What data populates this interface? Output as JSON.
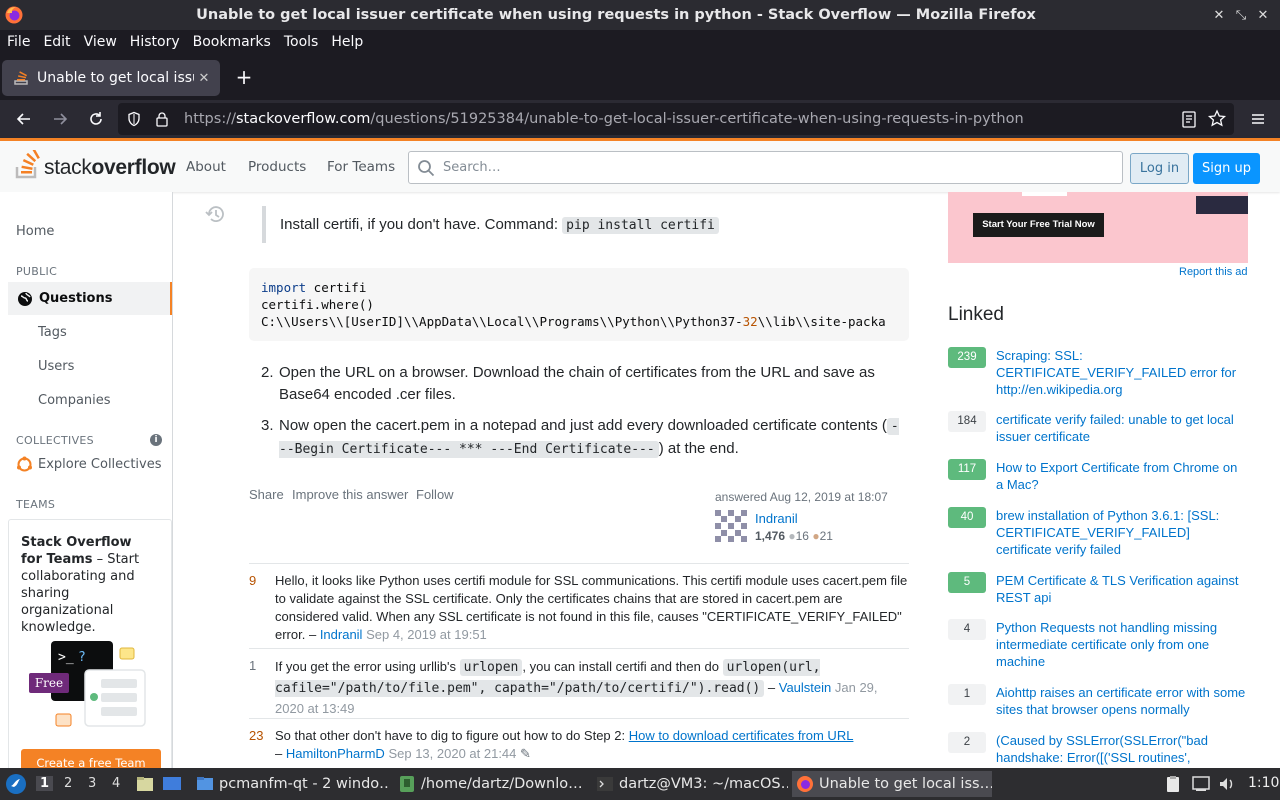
{
  "window": {
    "title": "Unable to get local issuer certificate when using requests in python - Stack Overflow — Mozilla Firefox"
  },
  "menubar": [
    "File",
    "Edit",
    "View",
    "History",
    "Bookmarks",
    "Tools",
    "Help"
  ],
  "tab": {
    "title": "Unable to get local issuer certificate"
  },
  "urlbar": {
    "prefix": "https://",
    "domain": "stackoverflow.com",
    "path": "/questions/51925384/unable-to-get-local-issuer-certificate-when-using-requests-in-python"
  },
  "so_header": {
    "logo_light": "stack",
    "logo_bold": "overflow",
    "nav": [
      "About",
      "Products",
      "For Teams"
    ],
    "search_placeholder": "Search…",
    "login": "Log in",
    "signup": "Sign up"
  },
  "leftbar": {
    "home": "Home",
    "public_label": "PUBLIC",
    "questions": "Questions",
    "tags": "Tags",
    "users": "Users",
    "companies": "Companies",
    "collectives_label": "COLLECTIVES",
    "explore_collectives": "Explore Collectives",
    "teams_label": "TEAMS",
    "teams_title": "Stack Overflow for Teams",
    "teams_text": " – Start collaborating and sharing organizational knowledge.",
    "free_badge": "Free",
    "teams_button": "Create a free Team"
  },
  "answer": {
    "quote_text": "Install certifi, if you don't have. Command: ",
    "quote_code": "pip install certifi",
    "code_line1_kw": "import",
    "code_line1_rest": " certifi",
    "code_line2": "certifi.where()",
    "code_line3_a": "C:\\\\Users\\\\[UserID]\\\\AppData\\\\Local\\\\Programs\\\\Python\\\\Python37-",
    "code_line3_num": "32",
    "code_line3_b": "\\\\lib\\\\site-packa",
    "step2_num": "2.",
    "step2": "Open the URL on a browser. Download the chain of certificates from the URL and save as Base64 encoded .cer files.",
    "step3_num": "3.",
    "step3_a": "Now open the cacert.pem in a notepad and just add every downloaded certificate contents (",
    "step3_code": "---Begin Certificate--- *** ---End Certificate---",
    "step3_b": ") at the end.",
    "share": "Share",
    "improve": "Improve this answer",
    "follow": "Follow",
    "answered": "answered Aug 12, 2019 at 18:07",
    "user_name": "Indranil",
    "user_rep": "1,476",
    "silver": "16",
    "bronze": "21"
  },
  "comments": [
    {
      "score": "9",
      "text": "Hello, it looks like Python uses certifi module for SSL communications. This certifi module uses cacert.pem file to validate against the SSL certificate. Only the certificates chains that are stored in cacert.pem are considered valid. When any SSL certificate is not found in this file, causes \"CERTIFICATE_VERIFY_FAILED\" error.",
      "author": "Indranil",
      "date": "Sep 4, 2019 at 19:51"
    },
    {
      "score": "1",
      "text_a": "If you get the error using urllib's ",
      "code_a": "urlopen",
      "text_b": ", you can install certifi and then do ",
      "code_b": "urlopen(url, cafile=\"/path/to/file.pem\", capath=\"/path/to/certifi/\").read()",
      "author": "Vaulstein",
      "date": "Jan 29, 2020 at 13:49"
    },
    {
      "score": "23",
      "text": "So that other don't have to dig to figure out how to do Step 2: ",
      "link": "How to download certificates from URL",
      "author": "HamiltonPharmD",
      "date": "Sep 13, 2020 at 21:44"
    }
  ],
  "ad": {
    "button": "Start Your Free Trial Now",
    "report": "Report this ad"
  },
  "linked": {
    "title": "Linked",
    "items": [
      {
        "count": "239",
        "accepted": true,
        "text": "Scraping: SSL: CERTIFICATE_VERIFY_FAILED error for http://en.wikipedia.org"
      },
      {
        "count": "184",
        "accepted": false,
        "text": "certificate verify failed: unable to get local issuer certificate"
      },
      {
        "count": "117",
        "accepted": true,
        "text": "How to Export Certificate from Chrome on a Mac?"
      },
      {
        "count": "40",
        "accepted": true,
        "text": "brew installation of Python 3.6.1: [SSL: CERTIFICATE_VERIFY_FAILED] certificate verify failed"
      },
      {
        "count": "5",
        "accepted": true,
        "text": "PEM Certificate & TLS Verification against REST api"
      },
      {
        "count": "4",
        "accepted": false,
        "text": "Python Requests not handling missing intermediate certificate only from one machine"
      },
      {
        "count": "1",
        "accepted": false,
        "text": "Aiohttp raises an certificate error with some sites that browser opens normally"
      },
      {
        "count": "2",
        "accepted": false,
        "text": "(Caused by SSLError(SSLError(\"bad handshake: Error([('SSL routines',"
      }
    ]
  },
  "taskbar": {
    "workspaces": [
      "1",
      "2",
      "3",
      "4"
    ],
    "tasks": [
      "pcmanfm-qt - 2 windo…",
      "/home/dartz/Downlo…",
      "dartz@VM3: ~/macOS…",
      "Unable to get local iss…"
    ],
    "clock": "1:10"
  },
  "colors": {
    "so_orange": "#f48225",
    "so_blue": "#0a95ff",
    "link_blue": "#0074cc",
    "accepted_green": "#5eba7d"
  }
}
